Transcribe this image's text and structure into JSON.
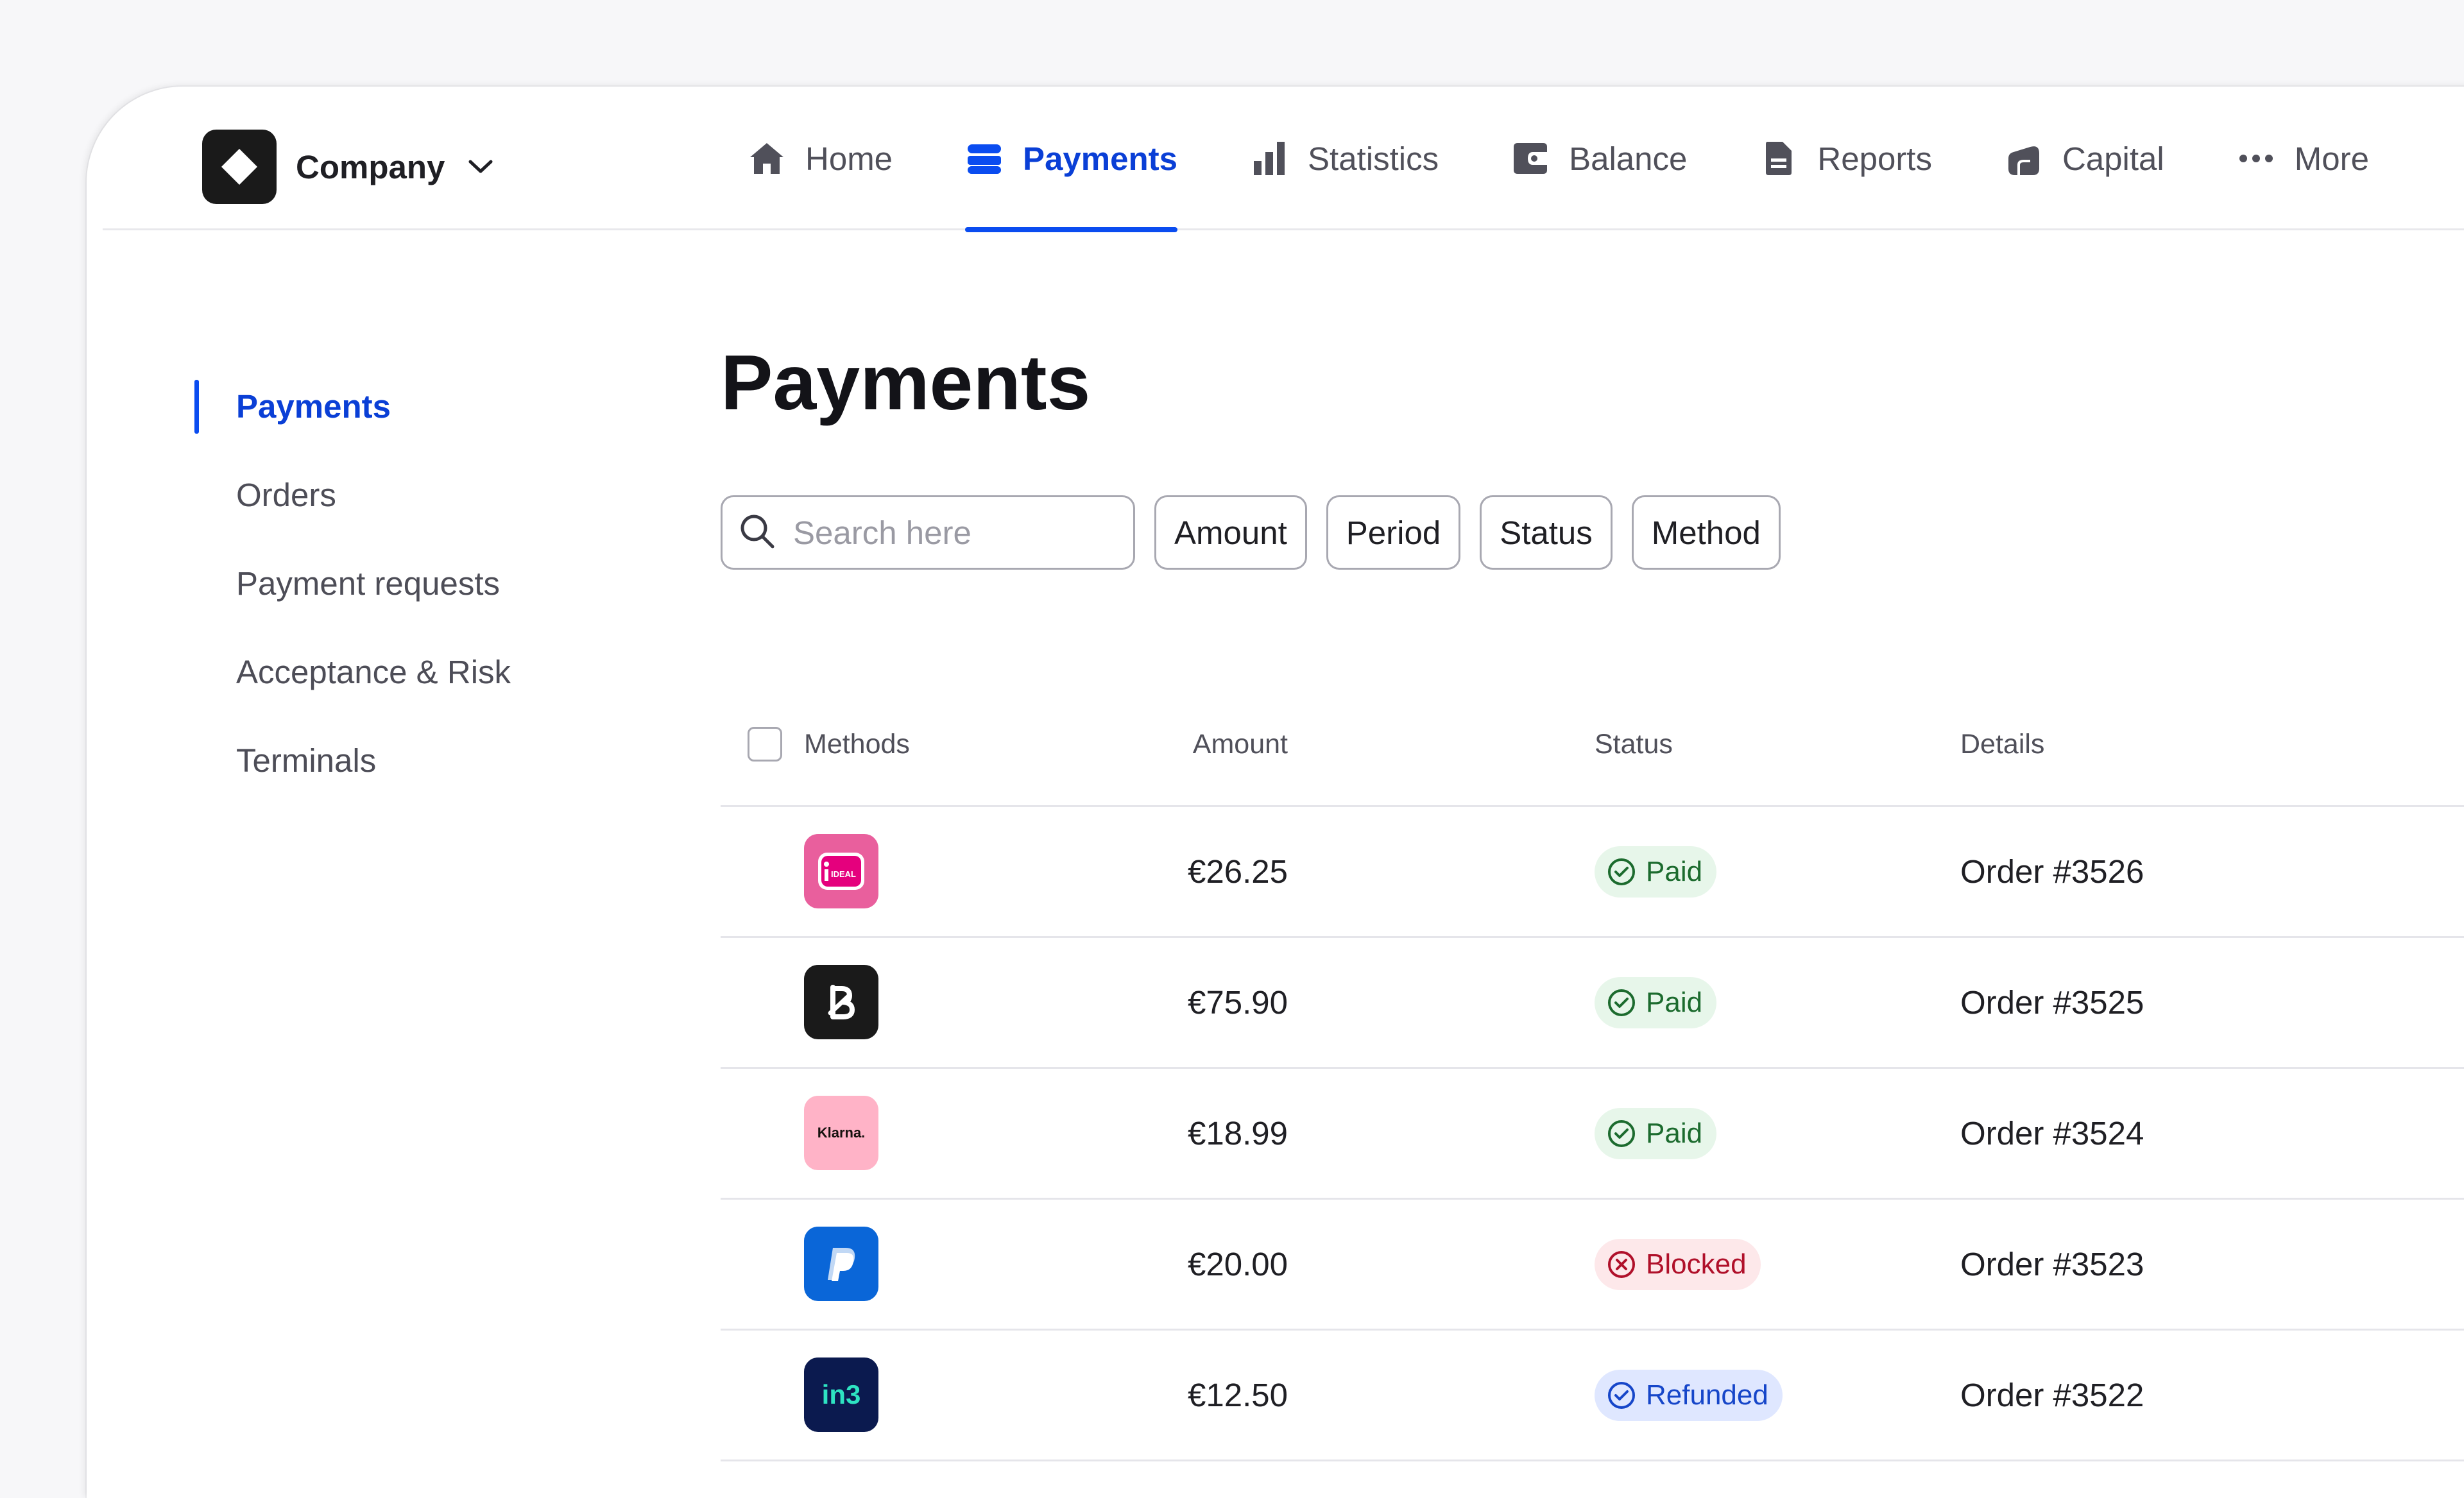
{
  "brand": {
    "name": "Company"
  },
  "nav": {
    "items": [
      {
        "label": "Home",
        "icon": "home-icon"
      },
      {
        "label": "Payments",
        "icon": "payments-icon"
      },
      {
        "label": "Statistics",
        "icon": "statistics-icon"
      },
      {
        "label": "Balance",
        "icon": "balance-icon"
      },
      {
        "label": "Reports",
        "icon": "reports-icon"
      },
      {
        "label": "Capital",
        "icon": "capital-icon"
      },
      {
        "label": "More",
        "icon": "more-icon"
      }
    ],
    "active": "Payments"
  },
  "sidebar": {
    "items": [
      {
        "label": "Payments"
      },
      {
        "label": "Orders"
      },
      {
        "label": "Payment requests"
      },
      {
        "label": "Acceptance & Risk"
      },
      {
        "label": "Terminals"
      }
    ],
    "active": "Payments"
  },
  "main": {
    "title": "Payments",
    "search": {
      "placeholder": "Search here",
      "value": ""
    },
    "filters": [
      "Amount",
      "Period",
      "Status",
      "Method"
    ]
  },
  "table": {
    "headers": {
      "methods": "Methods",
      "amount": "Amount",
      "status": "Status",
      "details": "Details"
    },
    "rows": [
      {
        "method": "iDEAL",
        "amount": "€26.25",
        "status": "Paid",
        "details": "Order #3526"
      },
      {
        "method": "Bancontact",
        "amount": "€75.90",
        "status": "Paid",
        "details": "Order #3525"
      },
      {
        "method": "Klarna.",
        "amount": "€18.99",
        "status": "Paid",
        "details": "Order #3524"
      },
      {
        "method": "PayPal",
        "amount": "€20.00",
        "status": "Blocked",
        "details": "Order #3523"
      },
      {
        "method": "in3",
        "amount": "€12.50",
        "status": "Refunded",
        "details": "Order #3522"
      }
    ]
  },
  "colors": {
    "accent": "#0a4cf0",
    "paid_bg": "#e7f6ea",
    "blocked_bg": "#fde8ea",
    "refunded_bg": "#dfe7ff"
  },
  "icon_labels": {
    "ideal": "IDEAL",
    "klarna": "Klarna.",
    "in3": "in3"
  }
}
